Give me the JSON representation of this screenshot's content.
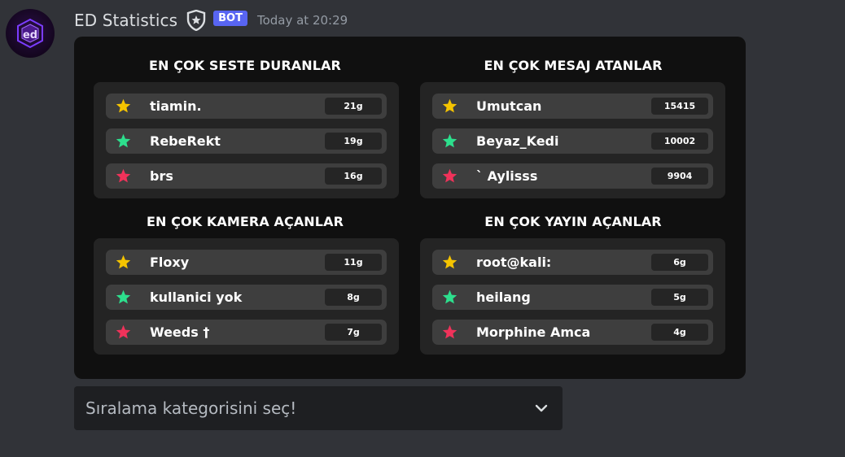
{
  "message": {
    "author": "ED Statistics",
    "bot_tag": "BOT",
    "timestamp": "Today at 20:29",
    "avatar_text": "ed"
  },
  "sections": [
    {
      "title": "EN ÇOK SESTE DURANLAR",
      "rows": [
        {
          "name": "tiamin.",
          "value": "21g",
          "rank_color": "#f5c400"
        },
        {
          "name": "RebeRekt",
          "value": "19g",
          "rank_color": "#2ddf8d"
        },
        {
          "name": "brs",
          "value": "16g",
          "rank_color": "#f0325a"
        }
      ]
    },
    {
      "title": "EN ÇOK MESAJ ATANLAR",
      "rows": [
        {
          "name": "Umutcan",
          "value": "15415",
          "rank_color": "#f5c400"
        },
        {
          "name": "Beyaz_Kedi",
          "value": "10002",
          "rank_color": "#2ddf8d"
        },
        {
          "name": "` Aylisss",
          "value": "9904",
          "rank_color": "#f0325a"
        }
      ]
    },
    {
      "title": "EN ÇOK KAMERA AÇANLAR",
      "rows": [
        {
          "name": "Floxy",
          "value": "11g",
          "rank_color": "#f5c400"
        },
        {
          "name": "kullanici yok",
          "value": "8g",
          "rank_color": "#2ddf8d"
        },
        {
          "name": "Weeds †",
          "value": "7g",
          "rank_color": "#f0325a"
        }
      ]
    },
    {
      "title": "EN ÇOK YAYIN AÇANLAR",
      "rows": [
        {
          "name": "root@kali:",
          "value": "6g",
          "rank_color": "#f5c400"
        },
        {
          "name": "heilang",
          "value": "5g",
          "rank_color": "#2ddf8d"
        },
        {
          "name": "Morphine Amca",
          "value": "4g",
          "rank_color": "#f0325a"
        }
      ]
    }
  ],
  "select_menu": {
    "placeholder": "Sıralama kategorisini seç!",
    "icon": "chevron-down-icon"
  },
  "colors": {
    "background": "#313338",
    "card": "#101010",
    "bot_tag": "#5865f2"
  }
}
